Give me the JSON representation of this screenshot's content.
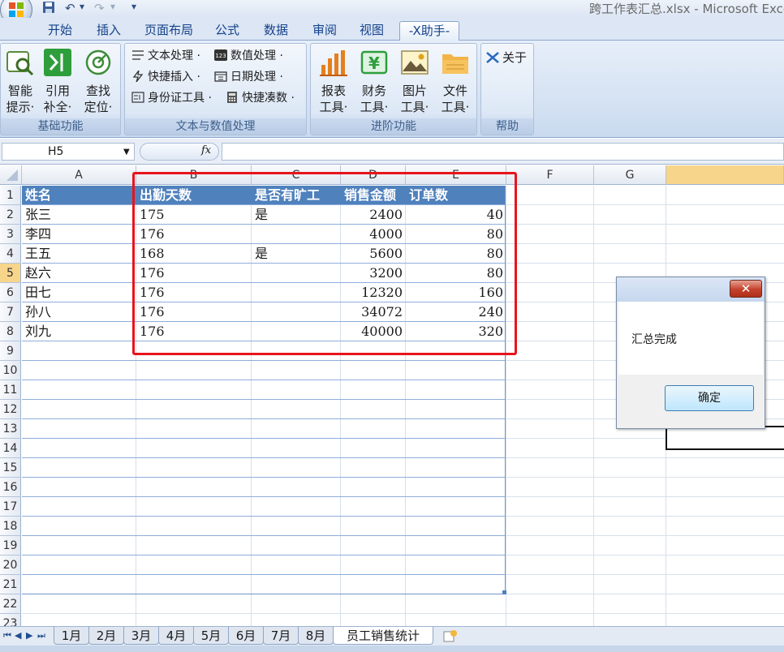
{
  "window": {
    "title": "跨工作表汇总.xlsx - Microsoft Exce"
  },
  "tabs": [
    {
      "label": "开始"
    },
    {
      "label": "插入"
    },
    {
      "label": "页面布局"
    },
    {
      "label": "公式"
    },
    {
      "label": "数据"
    },
    {
      "label": "审阅"
    },
    {
      "label": "视图"
    },
    {
      "label": "-X助手-",
      "active": true
    }
  ],
  "ribbon": {
    "basic": {
      "label": "基础功能",
      "buttons": [
        {
          "l1": "智能",
          "l2": "提示·",
          "icon": "smart-hint-icon"
        },
        {
          "l1": "引用",
          "l2": "补全·",
          "icon": "reference-complete-icon"
        },
        {
          "l1": "查找",
          "l2": "定位·",
          "icon": "find-locate-icon"
        }
      ]
    },
    "text": {
      "label": "文本与数值处理",
      "items": [
        {
          "label": "文本处理 ·",
          "icon": "text-process-icon"
        },
        {
          "label": "数值处理 ·",
          "icon": "number-process-icon"
        },
        {
          "label": "快捷插入 ·",
          "icon": "quick-insert-icon"
        },
        {
          "label": "日期处理 ·",
          "icon": "date-process-icon"
        },
        {
          "label": "身份证工具 ·",
          "icon": "id-card-tool-icon"
        },
        {
          "label": "快捷凑数 ·",
          "icon": "quick-sum-icon"
        }
      ]
    },
    "advanced": {
      "label": "进阶功能",
      "buttons": [
        {
          "l1": "报表",
          "l2": "工具·",
          "icon": "report-chart-icon"
        },
        {
          "l1": "财务",
          "l2": "工具·",
          "icon": "finance-yen-icon"
        },
        {
          "l1": "图片",
          "l2": "工具·",
          "icon": "picture-icon"
        },
        {
          "l1": "文件",
          "l2": "工具·",
          "icon": "folder-icon"
        }
      ]
    },
    "help": {
      "label": "帮助",
      "about": "关于"
    }
  },
  "formula": {
    "namebox": "H5",
    "fx": "fx",
    "value": ""
  },
  "columns": [
    "A",
    "B",
    "C",
    "D",
    "E",
    "F",
    "G"
  ],
  "rows": [
    "1",
    "2",
    "3",
    "4",
    "5",
    "6",
    "7",
    "8",
    "9",
    "10",
    "11",
    "12",
    "13",
    "14",
    "15",
    "16",
    "17",
    "18",
    "19",
    "20",
    "21",
    "22",
    "23"
  ],
  "table": {
    "headers": [
      "姓名",
      "出勤天数",
      "是否有旷工",
      "销售金额",
      "订单数"
    ],
    "rows": [
      [
        "张三",
        "175",
        "是",
        "2400",
        "40"
      ],
      [
        "李四",
        "176",
        "",
        "4000",
        "80"
      ],
      [
        "王五",
        "168",
        "是",
        "5600",
        "80"
      ],
      [
        "赵六",
        "176",
        "",
        "3200",
        "80"
      ],
      [
        "田七",
        "176",
        "",
        "12320",
        "160"
      ],
      [
        "孙八",
        "176",
        "",
        "34072",
        "240"
      ],
      [
        "刘九",
        "176",
        "",
        "40000",
        "320"
      ]
    ]
  },
  "sheets": [
    "1月",
    "2月",
    "3月",
    "4月",
    "5月",
    "6月",
    "7月",
    "8月",
    "员工销售统计"
  ],
  "active_sheet": "员工销售统计",
  "dialog": {
    "message": "汇总完成",
    "ok": "确定",
    "close": "✕"
  },
  "colors": {
    "accent": "#4f81bd",
    "highlight": "#e8141b",
    "selected_header": "#f7d58b"
  }
}
